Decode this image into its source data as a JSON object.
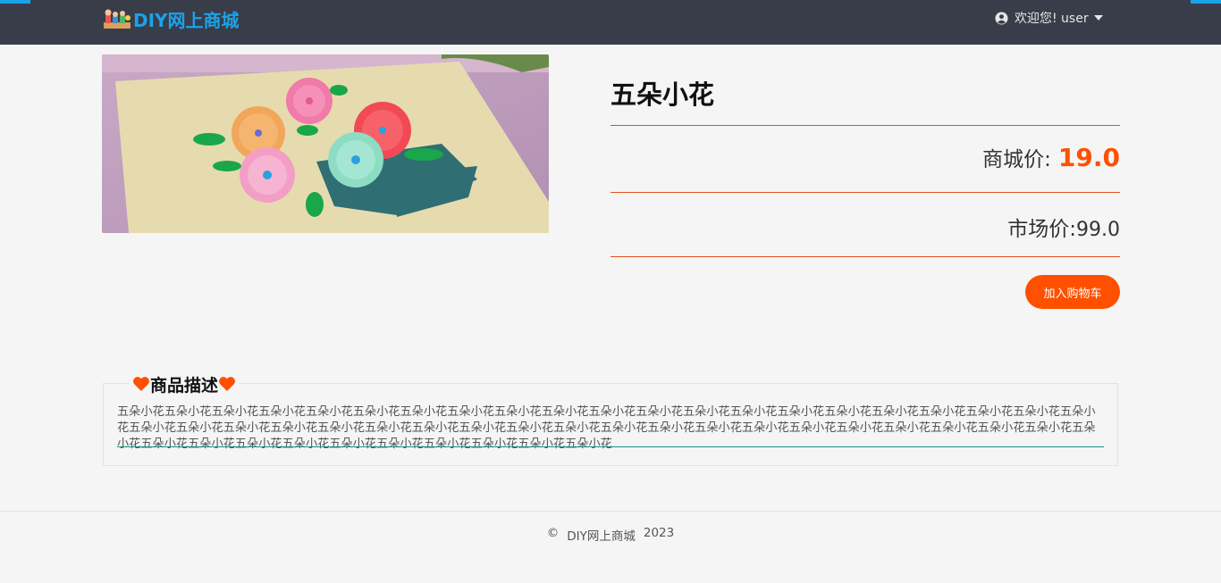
{
  "header": {
    "logo_text": "DIY网上商城",
    "user_greeting": "欢迎您! user",
    "accent_color": "#1aa3e8",
    "background_color": "#393d49"
  },
  "product": {
    "title": "五朵小花",
    "mall_price_label": "商城价:",
    "mall_price": "19.0",
    "market_price_label": "市场价:",
    "market_price": "99.0",
    "add_to_cart_label": "加入购物车",
    "price_color": "#ff5000"
  },
  "description": {
    "heading": "商品描述",
    "text": "五朵小花五朵小花五朵小花五朵小花五朵小花五朵小花五朵小花五朵小花五朵小花五朵小花五朵小花五朵小花五朵小花五朵小花五朵小花五朵小花五朵小花五朵小花五朵小花五朵小花五朵小花五朵小花五朵小花五朵小花五朵小花五朵小花五朵小花五朵小花五朵小花五朵小花五朵小花五朵小花五朵小花五朵小花五朵小花五朵小花五朵小花五朵小花五朵小花五朵小花五朵小花五朵小花五朵小花五朵小花五朵小花五朵小花五朵小花五朵小花五朵小花五朵小花五朵小花五朵小花"
  },
  "footer": {
    "copyright_symbol": "©",
    "site_name": "DIY网上商城",
    "year": "2023"
  },
  "icons": {
    "logo": "craft-logo-icon",
    "user": "user-circle-icon",
    "dropdown": "caret-down-icon",
    "heart": "heart-icon"
  }
}
